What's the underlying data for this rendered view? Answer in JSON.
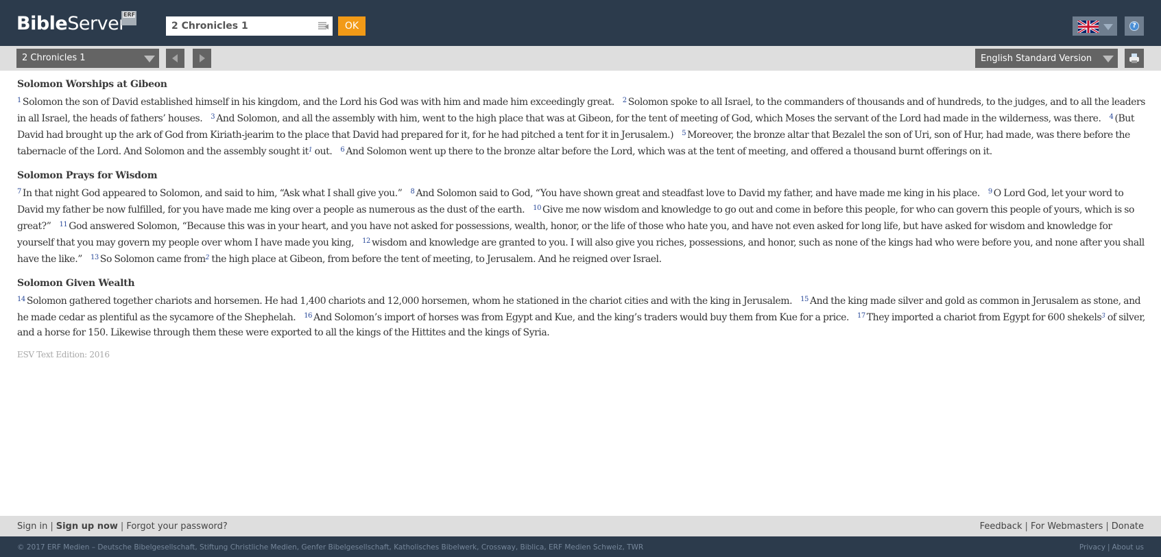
{
  "header": {
    "logo_bold": "Bible",
    "logo_light": "Server",
    "erf_badge": "ERF",
    "search": {
      "value": "2 Chronicles 1",
      "icon": "list-icon"
    },
    "ok_label": "OK",
    "language": {
      "flag": "uk-flag-icon",
      "icon": "chevron-down-icon"
    },
    "help_icon": "help-icon",
    "colors": {
      "header_bg": "#2c3b4c",
      "ok_button": "#f29a17"
    }
  },
  "toolbar": {
    "chapter_select": "2 Chronicles 1",
    "prev_icon": "arrow-left-icon",
    "next_icon": "arrow-right-icon",
    "version_select": "English Standard Version",
    "print_icon": "printer-icon"
  },
  "content": {
    "sections": [
      {
        "title": "Solomon Worships at Gibeon",
        "verses": [
          {
            "num": "1",
            "text": "Solomon the son of David established himself in his kingdom, and the Lord his God was with him and made him exceedingly great."
          },
          {
            "num": "2",
            "text": "Solomon spoke to all Israel, to the commanders of thousands and of hundreds, to the judges, and to all the leaders in all Israel, the heads of fathers’ houses."
          },
          {
            "num": "3",
            "text": "And Solomon, and all the assembly with him, went to the high place that was at Gibeon, for the tent of meeting of God, which Moses the servant of the Lord had made in the wilderness, was there."
          },
          {
            "num": "4",
            "text": "(But David had brought up the ark of God from Kiriath-jearim to the place that David had prepared for it, for he had pitched a tent for it in Jerusalem.)"
          },
          {
            "num": "5",
            "text": "Moreover, the bronze altar that Bezalel the son of Uri, son of Hur, had made, was there before the tabernacle of the Lord. And Solomon and the assembly sought it",
            "footnote": "1",
            "text_after": " out."
          },
          {
            "num": "6",
            "text": "And Solomon went up there to the bronze altar before the Lord, which was at the tent of meeting, and offered a thousand burnt offerings on it."
          }
        ]
      },
      {
        "title": "Solomon Prays for Wisdom",
        "verses": [
          {
            "num": "7",
            "text": "In that night God appeared to Solomon, and said to him, “Ask what I shall give you.”"
          },
          {
            "num": "8",
            "text": "And Solomon said to God, “You have shown great and steadfast love to David my father, and have made me king in his place."
          },
          {
            "num": "9",
            "text": "O Lord God, let your word to David my father be now fulfilled, for you have made me king over a people as numerous as the dust of the earth."
          },
          {
            "num": "10",
            "text": "Give me now wisdom and knowledge to go out and come in before this people, for who can govern this people of yours, which is so great?”"
          },
          {
            "num": "11",
            "text": "God answered Solomon, “Because this was in your heart, and you have not asked for possessions, wealth, honor, or the life of those who hate you, and have not even asked for long life, but have asked for wisdom and knowledge for yourself that you may govern my people over whom I have made you king,"
          },
          {
            "num": "12",
            "text": "wisdom and knowledge are granted to you. I will also give you riches, possessions, and honor, such as none of the kings had who were before you, and none after you shall have the like.”"
          },
          {
            "num": "13",
            "text": "So Solomon came from",
            "footnote": "2",
            "text_after": " the high place at Gibeon, from before the tent of meeting, to Jerusalem. And he reigned over Israel."
          }
        ]
      },
      {
        "title": "Solomon Given Wealth",
        "verses": [
          {
            "num": "14",
            "text": "Solomon gathered together chariots and horsemen. He had 1,400 chariots and 12,000 horsemen, whom he stationed in the chariot cities and with the king in Jerusalem."
          },
          {
            "num": "15",
            "text": "And the king made silver and gold as common in Jerusalem as stone, and he made cedar as plentiful as the sycamore of the Shephelah."
          },
          {
            "num": "16",
            "text": "And Solomon’s import of horses was from Egypt and Kue, and the king’s traders would buy them from Kue for a price."
          },
          {
            "num": "17",
            "text": "They imported a chariot from Egypt for 600 shekels",
            "footnote": "3",
            "text_after": " of silver, and a horse for 150. Likewise through them these were exported to all the kings of the Hittites and the kings of Syria."
          }
        ]
      }
    ],
    "edition_note": "ESV Text Edition: 2016"
  },
  "footer": {
    "left_links": [
      "Sign in",
      "Sign up now",
      "Forgot your password?"
    ],
    "right_links": [
      "Feedback",
      "For Webmasters",
      "Donate"
    ],
    "separator": "|",
    "copyright": "© 2017 ERF Medien – Deutsche Bibelgesellschaft, Stiftung Christliche Medien, Genfer Bibelgesellschaft, Katholisches Bibelwerk, Crossway, Biblica, ERF Medien Schweiz, TWR",
    "bottom_links": [
      "Privacy",
      "About us"
    ]
  }
}
